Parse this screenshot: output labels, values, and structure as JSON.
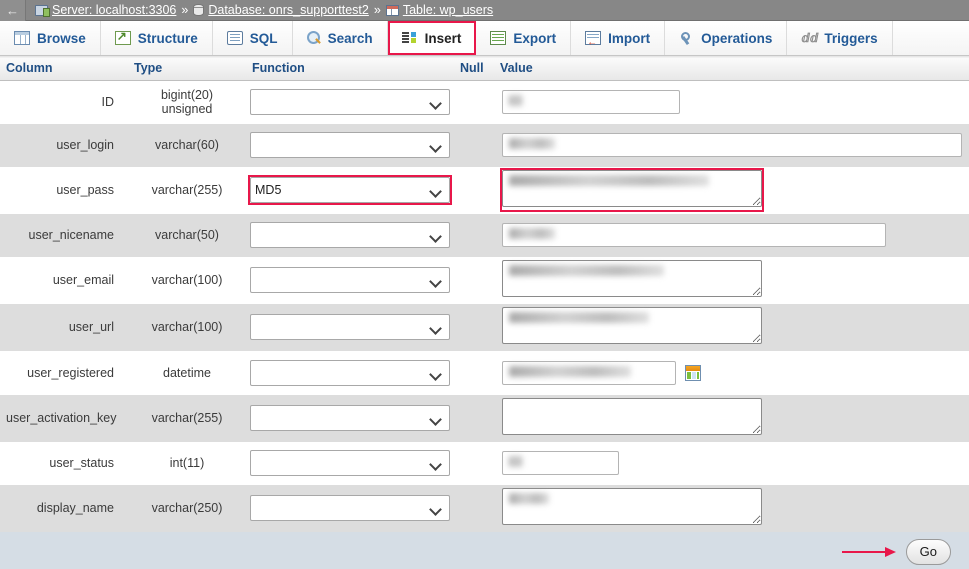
{
  "breadcrumb": {
    "back_icon": "back-arrow-icon",
    "items": [
      {
        "icon": "server-icon",
        "label": "Server: localhost:3306"
      },
      {
        "icon": "database-icon",
        "label": "Database: onrs_supporttest2"
      },
      {
        "icon": "table-icon",
        "label": "Table: wp_users"
      }
    ],
    "separator": "»"
  },
  "tabs": [
    {
      "label": "Browse",
      "icon": "browse-icon",
      "active": false,
      "highlighted": false
    },
    {
      "label": "Structure",
      "icon": "structure-icon",
      "active": false,
      "highlighted": false
    },
    {
      "label": "SQL",
      "icon": "sql-icon",
      "active": false,
      "highlighted": false
    },
    {
      "label": "Search",
      "icon": "search-icon",
      "active": false,
      "highlighted": false
    },
    {
      "label": "Insert",
      "icon": "insert-icon",
      "active": true,
      "highlighted": true
    },
    {
      "label": "Export",
      "icon": "export-icon",
      "active": false,
      "highlighted": false
    },
    {
      "label": "Import",
      "icon": "import-icon",
      "active": false,
      "highlighted": false
    },
    {
      "label": "Operations",
      "icon": "operations-icon",
      "active": false,
      "highlighted": false
    },
    {
      "label": "Triggers",
      "icon": "triggers-icon",
      "active": false,
      "highlighted": false
    }
  ],
  "table": {
    "headers": {
      "column": "Column",
      "type": "Type",
      "function": "Function",
      "null": "Null",
      "value": "Value"
    },
    "rows": [
      {
        "column": "ID",
        "type": "bigint(20) unsigned",
        "function": "",
        "function_highlighted": false,
        "null": "",
        "value": "",
        "value_redacted": true,
        "value_redacted_width": 14,
        "control": "input",
        "input_width": 178,
        "value_highlighted": false,
        "has_calendar": false
      },
      {
        "column": "user_login",
        "type": "varchar(60)",
        "function": "",
        "function_highlighted": false,
        "null": "",
        "value": "",
        "value_redacted": true,
        "value_redacted_width": 46,
        "control": "input",
        "input_width": 460,
        "value_highlighted": false,
        "has_calendar": false
      },
      {
        "column": "user_pass",
        "type": "varchar(255)",
        "function": "MD5",
        "function_highlighted": true,
        "null": "",
        "value": "",
        "value_redacted": true,
        "value_redacted_width": 200,
        "control": "textarea",
        "input_width": 260,
        "value_highlighted": true,
        "has_calendar": false
      },
      {
        "column": "user_nicename",
        "type": "varchar(50)",
        "function": "",
        "function_highlighted": false,
        "null": "",
        "value": "",
        "value_redacted": true,
        "value_redacted_width": 46,
        "control": "input",
        "input_width": 384,
        "value_highlighted": false,
        "has_calendar": false
      },
      {
        "column": "user_email",
        "type": "varchar(100)",
        "function": "",
        "function_highlighted": false,
        "null": "",
        "value": "",
        "value_redacted": true,
        "value_redacted_width": 155,
        "control": "textarea",
        "input_width": 260,
        "value_highlighted": false,
        "has_calendar": false
      },
      {
        "column": "user_url",
        "type": "varchar(100)",
        "function": "",
        "function_highlighted": false,
        "null": "",
        "value": "",
        "value_redacted": true,
        "value_redacted_width": 140,
        "control": "textarea",
        "input_width": 260,
        "value_highlighted": false,
        "has_calendar": false
      },
      {
        "column": "user_registered",
        "type": "datetime",
        "function": "",
        "function_highlighted": false,
        "null": "",
        "value": "",
        "value_redacted": true,
        "value_redacted_width": 122,
        "control": "input",
        "input_width": 174,
        "value_highlighted": false,
        "has_calendar": true
      },
      {
        "column": "user_activation_key",
        "type": "varchar(255)",
        "function": "",
        "function_highlighted": false,
        "null": "",
        "value": "",
        "value_redacted": false,
        "value_redacted_width": 0,
        "control": "textarea",
        "input_width": 260,
        "value_highlighted": false,
        "has_calendar": false
      },
      {
        "column": "user_status",
        "type": "int(11)",
        "function": "",
        "function_highlighted": false,
        "null": "",
        "value": "",
        "value_redacted": true,
        "value_redacted_width": 14,
        "control": "input",
        "input_width": 117,
        "value_highlighted": false,
        "has_calendar": false
      },
      {
        "column": "display_name",
        "type": "varchar(250)",
        "function": "",
        "function_highlighted": false,
        "null": "",
        "value": "",
        "value_redacted": true,
        "value_redacted_width": 40,
        "control": "textarea",
        "input_width": 260,
        "value_highlighted": false,
        "has_calendar": false
      }
    ]
  },
  "footer": {
    "go_label": "Go",
    "arrow_icon": "red-arrow-icon"
  },
  "colors": {
    "highlight": "#e8174a",
    "topbar": "#878787",
    "tab_link": "#235a97",
    "header_text": "#1f4e84",
    "row_even": "#dddddd",
    "footer_bg": "#d5dde5"
  }
}
